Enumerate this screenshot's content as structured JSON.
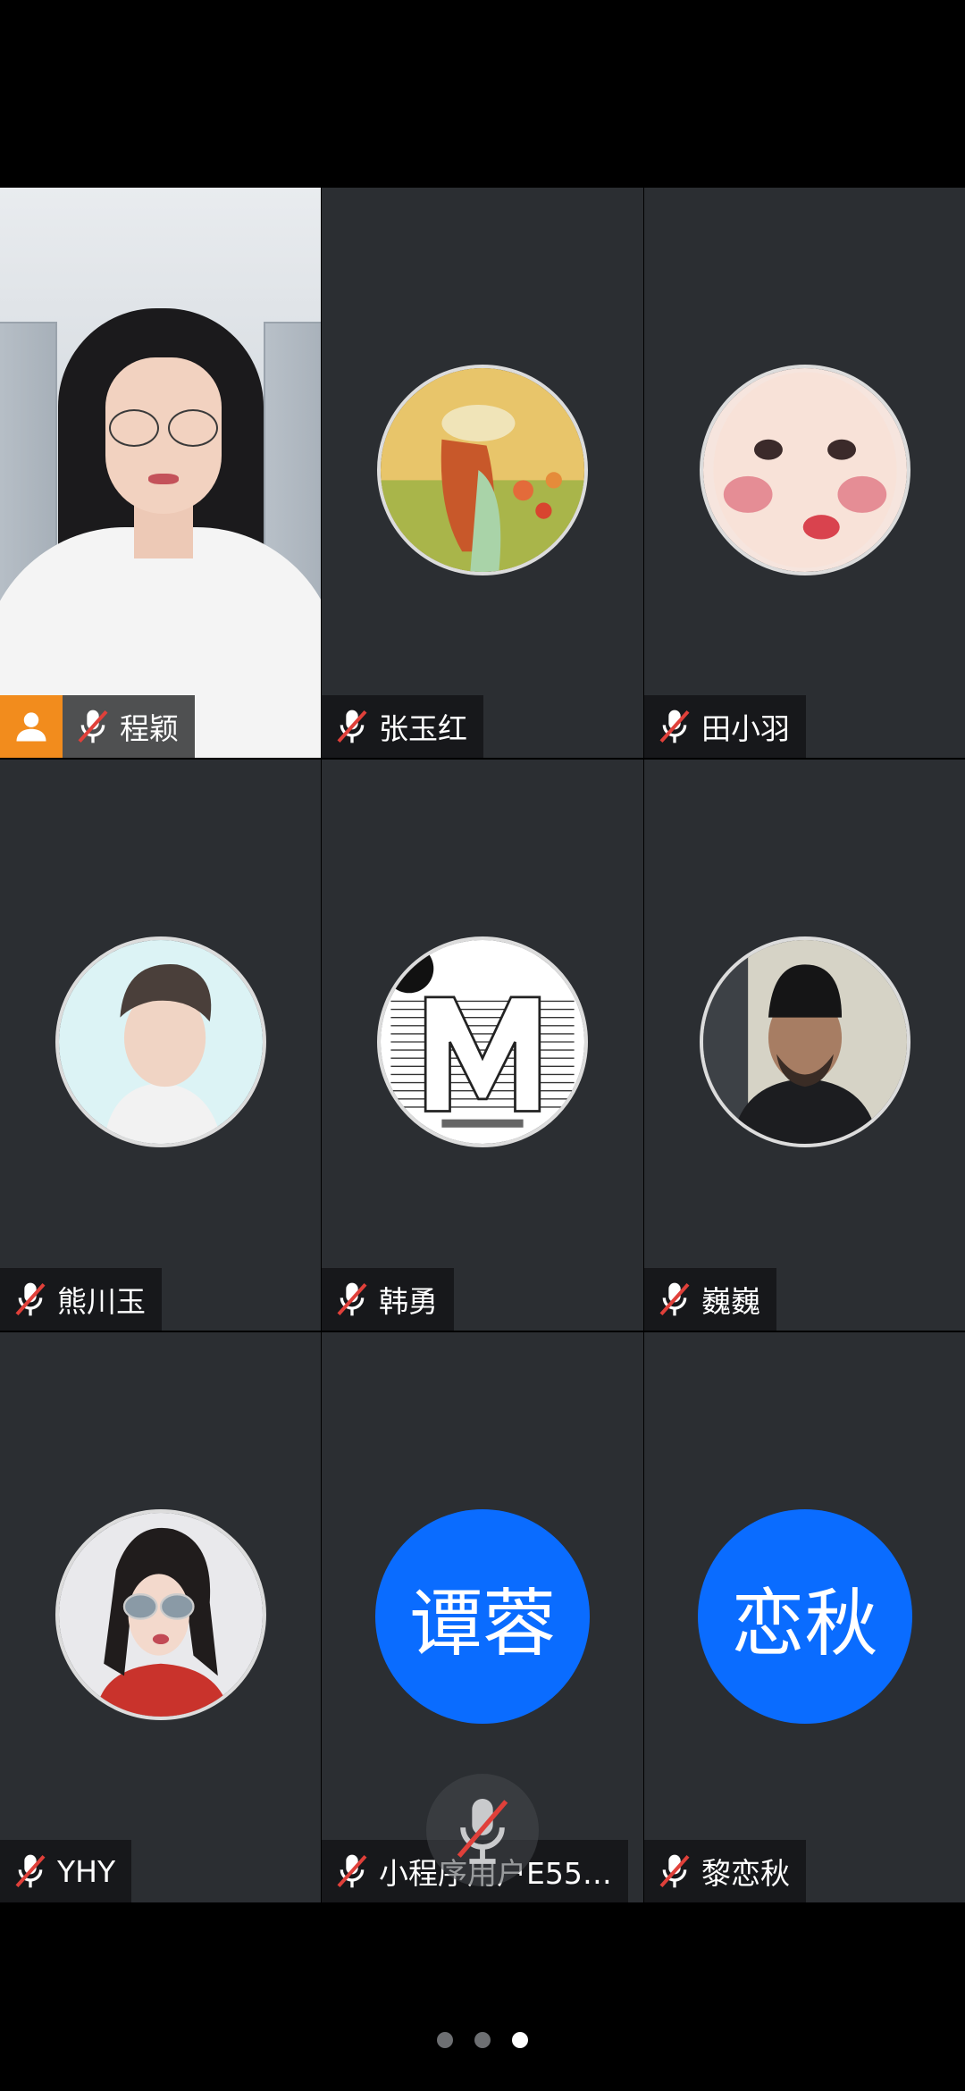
{
  "colors": {
    "tile_bg": "#2b2e32",
    "host_badge": "#f28c1d",
    "text_avatar_bg": "#0a6cff",
    "muted_slash": "#e0403a"
  },
  "participants": [
    {
      "name": "程颖",
      "muted": true,
      "host": true,
      "avatar": "camera-video"
    },
    {
      "name": "张玉红",
      "muted": true,
      "avatar": "photo-girl-in-flower-field"
    },
    {
      "name": "田小羽",
      "muted": true,
      "avatar": "photo-child-face"
    },
    {
      "name": "熊川玉",
      "muted": true,
      "avatar": "photo-young-man"
    },
    {
      "name": "韩勇",
      "muted": true,
      "avatar": "photo-m-design-logo"
    },
    {
      "name": "巍巍",
      "muted": true,
      "avatar": "photo-man-beanie"
    },
    {
      "name": "YHY",
      "muted": true,
      "avatar": "photo-woman-sunglasses"
    },
    {
      "name": "小程序用户E55…",
      "muted": true,
      "avatar_text": "谭蓉"
    },
    {
      "name": "黎恋秋",
      "muted": true,
      "avatar_text": "恋秋"
    }
  ],
  "floating_control": {
    "icon": "mic-muted-icon"
  },
  "pager": {
    "total": 3,
    "active": 3
  }
}
